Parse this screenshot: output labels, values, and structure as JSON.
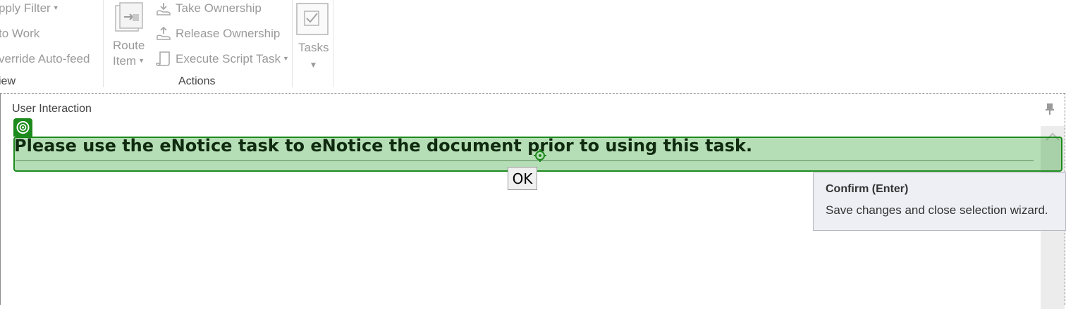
{
  "ribbon": {
    "view_group": {
      "apply_filter": "pply Filter",
      "go_to_work": "to Work",
      "override_autofeed": "verride Auto-feed",
      "label": "iew"
    },
    "actions_group": {
      "route_item_line1": "Route",
      "route_item_line2": "Item",
      "take_ownership": "Take Ownership",
      "release_ownership": "Release Ownership",
      "execute_script_task": "Execute Script Task",
      "label": "Actions"
    },
    "tasks_group": {
      "tasks": "Tasks"
    }
  },
  "panel": {
    "title": "User Interaction",
    "message": "Please use the eNotice task to eNotice the document prior to using this task.",
    "ok_label": "OK"
  },
  "tooltip": {
    "title": "Confirm (Enter)",
    "body": "Save changes and close selection wizard."
  },
  "colors": {
    "highlight": "#1c8a1c",
    "tooltip_bg": "#eeeff4"
  },
  "icons": [
    "caret-down-icon",
    "route-item-icon",
    "take-ownership-icon",
    "release-ownership-icon",
    "script-icon",
    "tasks-checkbox-icon",
    "pin-icon",
    "target-icon",
    "anchor-icon",
    "scroll-up-icon"
  ]
}
